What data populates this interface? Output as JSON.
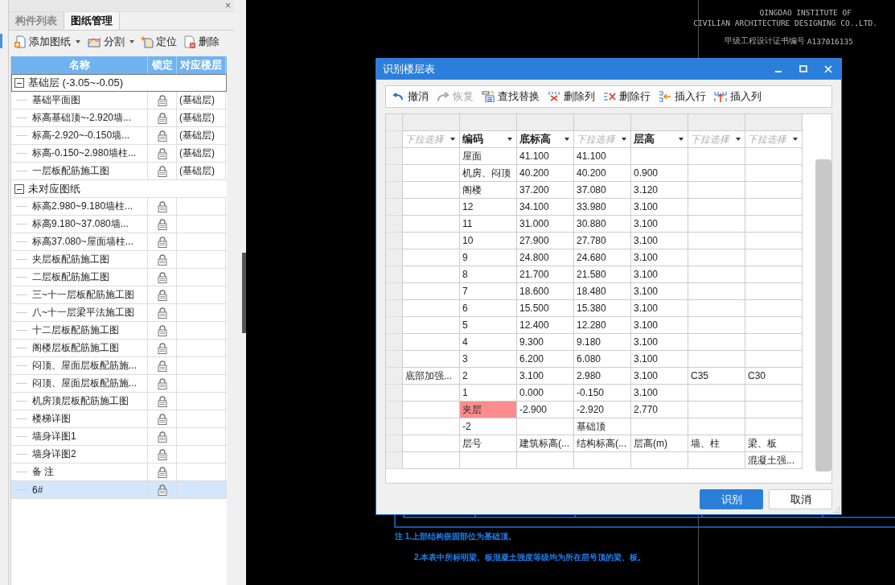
{
  "left_panel": {
    "close_symbol": "×",
    "tabs": [
      {
        "label": "构件列表",
        "selected": false
      },
      {
        "label": "图纸管理",
        "selected": true
      }
    ],
    "toolbar": [
      {
        "label": "添加图纸",
        "kind": "add",
        "dropdown": true
      },
      {
        "label": "分割",
        "kind": "split",
        "dropdown": true
      },
      {
        "label": "定位",
        "kind": "locate",
        "dropdown": false
      },
      {
        "label": "删除",
        "kind": "delete",
        "dropdown": false
      }
    ],
    "columns": [
      "名称",
      "锁定",
      "对应楼层"
    ],
    "groups": [
      {
        "label": "基础层 (-3.05~-0.05)",
        "expanded": true,
        "selected": true,
        "children": [
          {
            "name": "基础平面图",
            "floor": "(基础层)",
            "selected": false
          },
          {
            "name": "标高基础顶~-2.920墙...",
            "floor": "(基础层)",
            "selected": false
          },
          {
            "name": "标高-2.920~-0.150墙...",
            "floor": "(基础层)",
            "selected": false
          },
          {
            "name": "标高-0.150~2.980墙柱...",
            "floor": "(基础层)",
            "selected": false
          },
          {
            "name": "一层板配筋施工图",
            "floor": "(基础层)",
            "selected": false
          }
        ]
      },
      {
        "label": "未对应图纸",
        "expanded": true,
        "selected": false,
        "children": [
          {
            "name": "标高2.980~9.180墙柱...",
            "selected": false
          },
          {
            "name": "标高9.180~37.080墙...",
            "selected": false
          },
          {
            "name": "标高37.080~屋面墙柱...",
            "selected": false
          },
          {
            "name": "夹层板配筋施工图",
            "selected": false
          },
          {
            "name": "二层板配筋施工图",
            "selected": false
          },
          {
            "name": "三~十一层板配筋施工图",
            "selected": false
          },
          {
            "name": "八~十一层梁平法施工图",
            "selected": false
          },
          {
            "name": "十二层板配筋施工图",
            "selected": false
          },
          {
            "name": "阁楼层板配筋施工图",
            "selected": false
          },
          {
            "name": "闷顶、屋面层板配筋施...",
            "selected": false
          },
          {
            "name": "闷顶、屋面层板配筋施...",
            "selected": false
          },
          {
            "name": "机房顶层板配筋施工图",
            "selected": false
          },
          {
            "name": "楼梯详图",
            "selected": false
          },
          {
            "name": "墙身详图1",
            "selected": false
          },
          {
            "name": "墙身详图2",
            "selected": false
          },
          {
            "name": "备 注",
            "selected": false
          },
          {
            "name": "6#",
            "selected": true
          }
        ]
      }
    ]
  },
  "drawing": {
    "header": [
      "QINGDAO INSTITUTE OF",
      "CIVILIAN ARCHITECTURE DESIGNING CO.,LTD."
    ],
    "certificate_label": "甲级工程设计证书编号",
    "certificate": "A137016135",
    "notes": [
      "注 1.上部结构嵌固部位为基础顶。",
      "2.本表中所标明梁、板混凝土强度等级均为所在层号顶的梁、板。"
    ]
  },
  "dialog": {
    "title": "识别楼层表",
    "toolbar": [
      {
        "label": "撤消",
        "kind": "undo",
        "disabled": false
      },
      {
        "label": "恢复",
        "kind": "redo",
        "disabled": true
      },
      {
        "label": "查找替换",
        "kind": "find",
        "disabled": false
      },
      {
        "label": "删除列",
        "kind": "delete-column",
        "disabled": false
      },
      {
        "label": "删除行",
        "kind": "delete-row",
        "disabled": false
      },
      {
        "label": "插入行",
        "kind": "insert-row",
        "disabled": false
      },
      {
        "label": "插入列",
        "kind": "insert-column",
        "disabled": false
      }
    ],
    "column_selectors": [
      {
        "placeholder": "下拉选择"
      },
      {
        "value": "编码"
      },
      {
        "value": "底标高"
      },
      {
        "placeholder": "下拉选择"
      },
      {
        "value": "层高"
      },
      {
        "placeholder": "下拉选择"
      },
      {
        "placeholder": "下拉选择"
      }
    ],
    "rows": [
      [
        null,
        "屋面",
        "41.100",
        "41.100",
        null,
        null,
        null
      ],
      [
        null,
        "机房、闷顶",
        "40.200",
        "40.200",
        "0.900",
        null,
        null
      ],
      [
        null,
        "阁楼",
        "37.200",
        "37.080",
        "3.120",
        null,
        null
      ],
      [
        null,
        "12",
        "34.100",
        "33.980",
        "3.100",
        null,
        null
      ],
      [
        null,
        "11",
        "31.000",
        "30.880",
        "3.100",
        null,
        null
      ],
      [
        null,
        "10",
        "27.900",
        "27.780",
        "3.100",
        null,
        null
      ],
      [
        null,
        "9",
        "24.800",
        "24.680",
        "3.100",
        null,
        null
      ],
      [
        null,
        "8",
        "21.700",
        "21.580",
        "3.100",
        null,
        null
      ],
      [
        null,
        "7",
        "18.600",
        "18.480",
        "3.100",
        null,
        null
      ],
      [
        null,
        "6",
        "15.500",
        "15.380",
        "3.100",
        null,
        null
      ],
      [
        null,
        "5",
        "12.400",
        "12.280",
        "3.100",
        null,
        null
      ],
      [
        null,
        "4",
        "9.300",
        "9.180",
        "3.100",
        null,
        null
      ],
      [
        null,
        "3",
        "6.200",
        "6.080",
        "3.100",
        null,
        null
      ],
      [
        "底部加强...",
        "2",
        "3.100",
        "2.980",
        "3.100",
        "C35",
        "C30"
      ],
      [
        null,
        "1",
        "0.000",
        "-0.150",
        "3.100",
        null,
        null
      ],
      [
        null,
        {
          "text": "夹层",
          "color": "#ff8c8c"
        },
        "-2.900",
        "-2.920",
        "2.770",
        null,
        null
      ],
      [
        null,
        "-2",
        null,
        "基础顶",
        null,
        null,
        null
      ],
      [
        null,
        "层号",
        "建筑标高(...",
        "结构标高(...",
        "层高(m)",
        "墙、柱",
        "梁、板"
      ],
      [
        null,
        null,
        null,
        null,
        null,
        null,
        "混凝土强..."
      ]
    ],
    "buttons": [
      {
        "label": "识别",
        "primary": true
      },
      {
        "label": "取消",
        "primary": false
      }
    ]
  }
}
